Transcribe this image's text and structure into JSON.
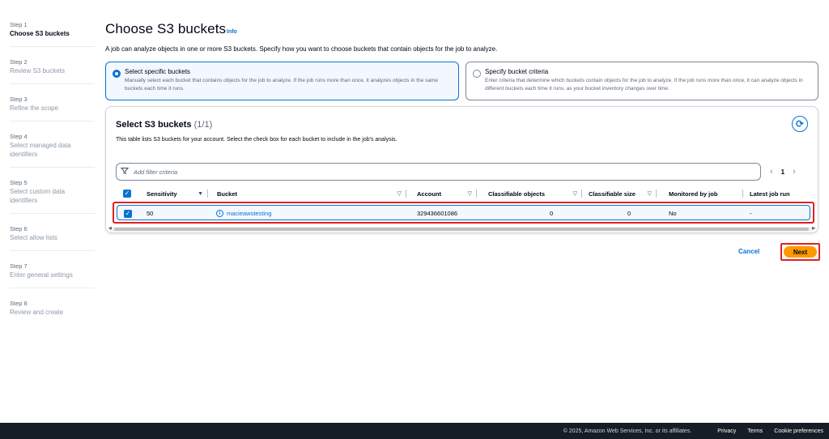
{
  "steps": [
    {
      "num": "Step 1",
      "title": "Choose S3 buckets",
      "active": true
    },
    {
      "num": "Step 2",
      "title": "Review S3 buckets"
    },
    {
      "num": "Step 3",
      "title": "Refine the scope"
    },
    {
      "num": "Step 4",
      "title": "Select managed data identifiers"
    },
    {
      "num": "Step 5",
      "title": "Select custom data identifiers"
    },
    {
      "num": "Step 6",
      "title": "Select allow lists"
    },
    {
      "num": "Step 7",
      "title": "Enter general settings"
    },
    {
      "num": "Step 8",
      "title": "Review and create"
    }
  ],
  "header": {
    "title": "Choose S3 buckets",
    "info": "Info",
    "description": "A job can analyze objects in one or more S3 buckets. Specify how you want to choose buckets that contain objects for the job to analyze."
  },
  "options": [
    {
      "title": "Select specific buckets",
      "desc": "Manually select each bucket that contains objects for the job to analyze. If the job runs more than once, it analyzes objects in the same buckets each time it runs.",
      "selected": true
    },
    {
      "title": "Specify bucket criteria",
      "desc": "Enter criteria that determine which buckets contain objects for the job to analyze. If the job runs more than once, it can analyze objects in different buckets each time it runs, as your bucket inventory changes over time.",
      "selected": false
    }
  ],
  "table": {
    "title": "Select S3 buckets",
    "count": "(1/1)",
    "description": "This table lists S3 buckets for your account. Select the check box for each bucket to include in the job's analysis.",
    "filter_placeholder": "Add filter criteria",
    "page": "1",
    "columns": [
      "Sensitivity",
      "Bucket",
      "Account",
      "Classifiable objects",
      "Classifiable size",
      "Monitored by job",
      "Latest job run"
    ],
    "rows": [
      {
        "sensitivity": "50",
        "bucket": "macieawstesting",
        "account": "329436601086",
        "classifiable_objects": "0",
        "classifiable_size": "0",
        "monitored": "No",
        "latest_run": "-",
        "checked": true
      }
    ]
  },
  "actions": {
    "cancel": "Cancel",
    "next": "Next"
  },
  "footer": {
    "copyright": "© 2025, Amazon Web Services, Inc. or its affiliates.",
    "links": [
      "Privacy",
      "Terms",
      "Cookie preferences"
    ]
  },
  "colors": {
    "accent": "#0972d3",
    "primary_button": "#ff9900",
    "highlight": "#e0201f",
    "footer_bg": "#161d26"
  }
}
